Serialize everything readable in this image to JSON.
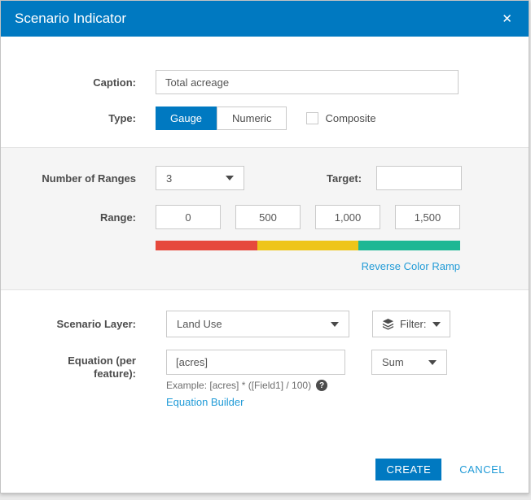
{
  "dialog": {
    "title": "Scenario Indicator",
    "close_icon": "✕"
  },
  "caption": {
    "label": "Caption:",
    "value": "Total acreage"
  },
  "type": {
    "label": "Type:",
    "options": [
      {
        "label": "Gauge",
        "selected": true
      },
      {
        "label": "Numeric",
        "selected": false
      }
    ],
    "composite_label": "Composite",
    "composite_checked": false
  },
  "ranges": {
    "number_label": "Number of Ranges",
    "number_value": "3",
    "target_label": "Target:",
    "target_value": "",
    "range_label": "Range:",
    "range_values": [
      "0",
      "500",
      "1,000",
      "1,500"
    ],
    "ramp_colors": [
      "#e6493c",
      "#eec51b",
      "#1eb794"
    ],
    "reverse_link": "Reverse Color Ramp"
  },
  "layer": {
    "label": "Scenario Layer:",
    "value": "Land Use",
    "filter_label": "Filter:"
  },
  "equation": {
    "label_line1": "Equation (per",
    "label_line2": "feature):",
    "value": "[acres]",
    "aggregation": "Sum",
    "example": "Example: [acres] * ([Field1] / 100)",
    "help_icon": "?",
    "builder_link": "Equation Builder"
  },
  "footer": {
    "create_label": "CREATE",
    "cancel_label": "CANCEL"
  },
  "colors": {
    "header": "#0079c1",
    "accent": "#0079c1",
    "link": "#219bd7"
  }
}
